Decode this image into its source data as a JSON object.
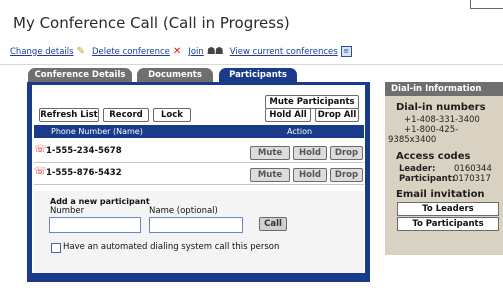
{
  "title": "My Conference Call (Call in Progress)",
  "top_links": [
    {
      "label": "Change details",
      "icon": "pencil-icon"
    },
    {
      "label": "Delete conference",
      "icon": "close-icon"
    },
    {
      "label": "Join",
      "icon": "join-icon"
    },
    {
      "label": "View current conferences",
      "icon": "list-icon"
    }
  ],
  "tabs": [
    {
      "label": "Conference Details",
      "active": false
    },
    {
      "label": "Documents",
      "active": false
    },
    {
      "label": "Participants",
      "active": true
    }
  ],
  "participants_panel": {
    "mute_participants_label": "Mute Participants",
    "hold_all_label": "Hold All",
    "drop_all_label": "Drop All",
    "refresh_list_label": "Refresh List",
    "record_label": "Record",
    "lock_label": "Lock",
    "columns": {
      "phone": "Phone Number (Name)",
      "action": "Action"
    },
    "rows": [
      {
        "number": "1-555-234-5678",
        "mute": "Mute",
        "hold": "Hold",
        "drop": "Drop"
      },
      {
        "number": "1-555-876-5432",
        "mute": "Mute",
        "hold": "Hold",
        "drop": "Drop"
      }
    ],
    "add_participant": {
      "heading": "Add a new participant",
      "number_label": "Number",
      "number_value": "",
      "name_label": "Name (optional)",
      "name_value": "",
      "call_label": "Call",
      "auto_dial_label": "Have an automated dialing system call this person",
      "auto_dial_checked": false
    }
  },
  "dialin": {
    "header": "Dial-in Information",
    "numbers_heading": "Dial-in numbers",
    "numbers_lines": [
      "+1-408-331-3400",
      "+1-800-425-",
      "9385x3400"
    ],
    "access_heading": "Access codes",
    "leader_label": "Leader:",
    "leader_code": "0160344",
    "participant_label": "Participant:",
    "participant_code": "0170317",
    "email_heading": "Email invitation",
    "to_leaders_label": "To Leaders",
    "to_participants_label": "To Participants"
  },
  "colors": {
    "accent": "#1a3a8c",
    "link": "#1b3e9b",
    "sidebar_bg": "#d9d2c3",
    "alert": "#d81e1e"
  }
}
